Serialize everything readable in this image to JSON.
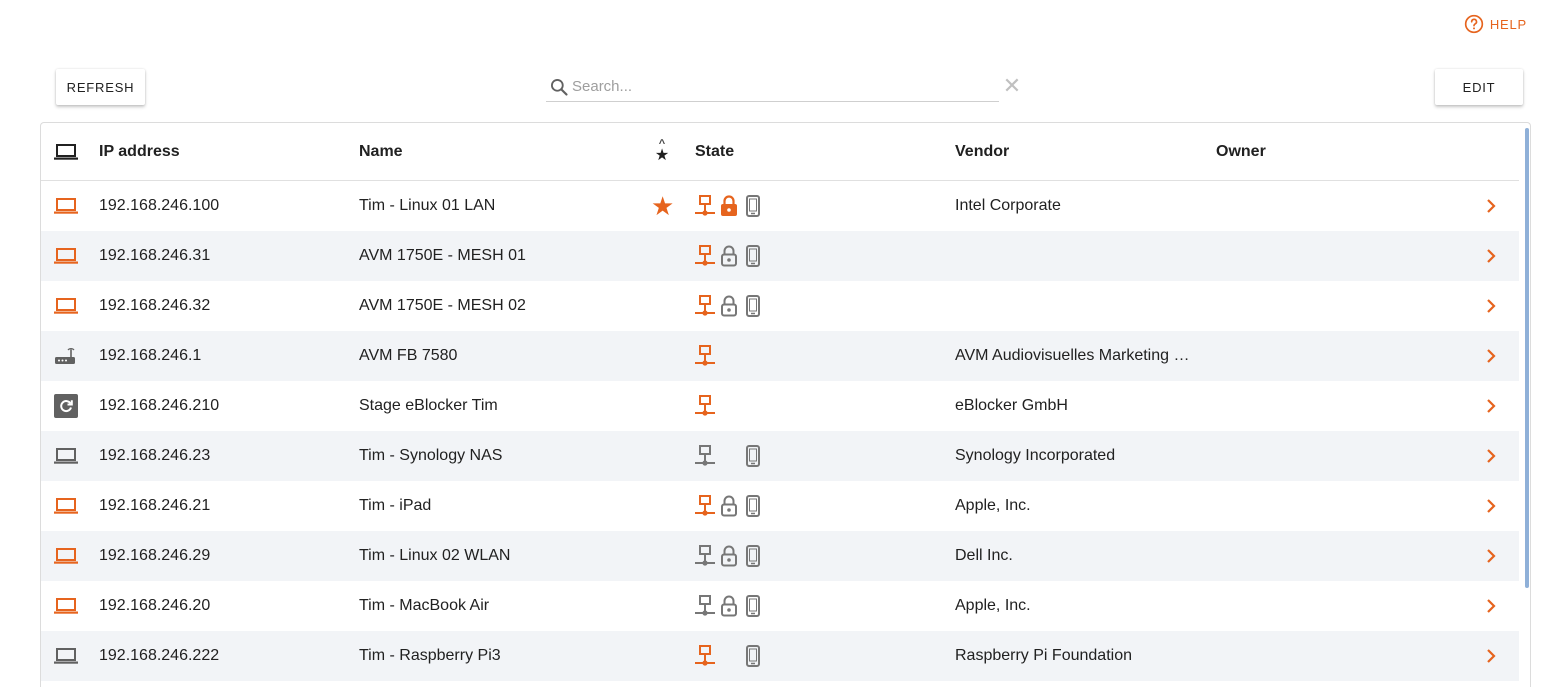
{
  "help": {
    "label": "HELP"
  },
  "toolbar": {
    "refresh_label": "REFRESH",
    "edit_label": "EDIT"
  },
  "search": {
    "placeholder": "Search...",
    "value": ""
  },
  "colors": {
    "accent": "#e6641e",
    "inactive": "#777777",
    "row_alt": "#f2f4f7"
  },
  "table": {
    "headers": {
      "ip": "IP address",
      "name": "Name",
      "state": "State",
      "vendor": "Vendor",
      "owner": "Owner"
    },
    "rows": [
      {
        "device_icon": "laptop-icon",
        "icon_active": true,
        "ip": "192.168.246.100",
        "name": "Tim - Linux 01 LAN",
        "favorite": true,
        "network": "active",
        "lock": "filled",
        "mobile": "inactive",
        "vendor": "Intel Corporate",
        "owner": ""
      },
      {
        "device_icon": "laptop-icon",
        "icon_active": true,
        "ip": "192.168.246.31",
        "name": "AVM 1750E - MESH 01",
        "favorite": false,
        "network": "active",
        "lock": "outline",
        "mobile": "inactive",
        "vendor": "",
        "owner": ""
      },
      {
        "device_icon": "laptop-icon",
        "icon_active": true,
        "ip": "192.168.246.32",
        "name": "AVM 1750E - MESH 02",
        "favorite": false,
        "network": "active",
        "lock": "outline",
        "mobile": "inactive",
        "vendor": "",
        "owner": ""
      },
      {
        "device_icon": "router-icon",
        "icon_active": false,
        "ip": "192.168.246.1",
        "name": "AVM FB 7580",
        "favorite": false,
        "network": "active",
        "lock": "none",
        "mobile": "none",
        "vendor": "AVM Audiovisuelles Marketing …",
        "owner": ""
      },
      {
        "device_icon": "eblocker-icon",
        "icon_active": false,
        "ip": "192.168.246.210",
        "name": "Stage eBlocker Tim",
        "favorite": false,
        "network": "active",
        "lock": "none",
        "mobile": "none",
        "vendor": "eBlocker GmbH",
        "owner": ""
      },
      {
        "device_icon": "laptop-icon",
        "icon_active": false,
        "ip": "192.168.246.23",
        "name": "Tim - Synology NAS",
        "favorite": false,
        "network": "inactive",
        "lock": "empty",
        "mobile": "inactive",
        "vendor": "Synology Incorporated",
        "owner": ""
      },
      {
        "device_icon": "laptop-icon",
        "icon_active": true,
        "ip": "192.168.246.21",
        "name": "Tim - iPad",
        "favorite": false,
        "network": "active",
        "lock": "outline",
        "mobile": "inactive",
        "vendor": "Apple, Inc.",
        "owner": ""
      },
      {
        "device_icon": "laptop-icon",
        "icon_active": true,
        "ip": "192.168.246.29",
        "name": "Tim - Linux 02 WLAN",
        "favorite": false,
        "network": "inactive",
        "lock": "outline",
        "mobile": "inactive",
        "vendor": "Dell Inc.",
        "owner": ""
      },
      {
        "device_icon": "laptop-icon",
        "icon_active": true,
        "ip": "192.168.246.20",
        "name": "Tim - MacBook Air",
        "favorite": false,
        "network": "inactive",
        "lock": "outline",
        "mobile": "inactive",
        "vendor": "Apple, Inc.",
        "owner": ""
      },
      {
        "device_icon": "laptop-icon",
        "icon_active": false,
        "ip": "192.168.246.222",
        "name": "Tim - Raspberry Pi3",
        "favorite": false,
        "network": "active",
        "lock": "empty",
        "mobile": "inactive",
        "vendor": "Raspberry Pi Foundation",
        "owner": ""
      }
    ]
  }
}
